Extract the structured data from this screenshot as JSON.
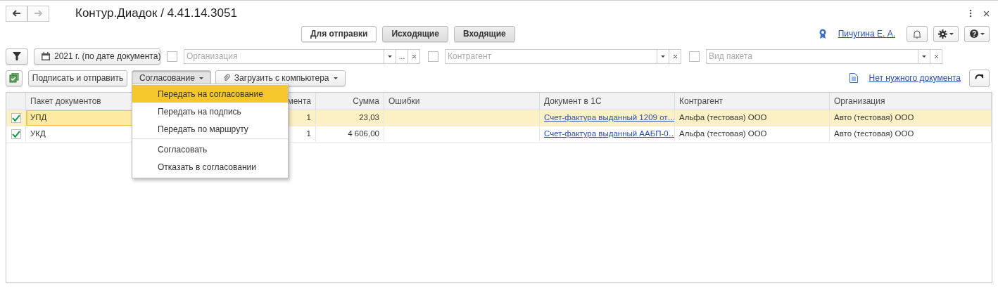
{
  "window": {
    "title": "Контур.Диадок / 4.41.14.3051"
  },
  "nav": {
    "back": {
      "disabled": false
    },
    "forward": {
      "disabled": true
    }
  },
  "mode_buttons": [
    {
      "label": "Для отправки",
      "selected": true
    },
    {
      "label": "Исходящие",
      "selected": false
    },
    {
      "label": "Входящие",
      "selected": false
    }
  ],
  "user": {
    "name": "Пичугина Е. А."
  },
  "filters": {
    "period": "2021 г. (по дате документа)",
    "fields": [
      {
        "kind": "choose",
        "placeholder": "Организация",
        "checked": false,
        "choose_button": "..."
      },
      {
        "kind": "plain",
        "placeholder": "Контрагент",
        "checked": false
      },
      {
        "kind": "plain",
        "placeholder": "Вид пакета",
        "checked": false
      }
    ]
  },
  "toolbar": {
    "sign_button": "Подписать и отправить",
    "approval_button": "Согласование",
    "upload_button": "Загрузить с компьютера",
    "missing_link": "Нет нужного документа"
  },
  "table": {
    "columns": [
      "Пакет документов",
      "мента",
      "Сумма",
      "Ошибки",
      "Документ в 1С",
      "Контрагент",
      "Организация"
    ],
    "rows": [
      {
        "checked": true,
        "selected": true,
        "package": "УПД",
        "column_3": "1",
        "sum": "23,03",
        "document": "Счет-фактура выданный 1209 от…",
        "counterparty": "Альфа (тестовая) ООО",
        "organization": "Авто (тестовая) ООО"
      },
      {
        "checked": true,
        "selected": false,
        "package": "УКД",
        "column_3": "1",
        "sum": "4 606,00",
        "document": "Счет-фактура выданный ААБП-0…",
        "counterparty": "Альфа (тестовая) ООО",
        "organization": "Авто (тестовая) ООО"
      }
    ]
  },
  "approval_menu": {
    "items": [
      {
        "label": "Передать на согласование",
        "selected": true,
        "separator_before": false
      },
      {
        "label": "Передать на подпись",
        "selected": false,
        "separator_before": false
      },
      {
        "label": "Передать по маршруту",
        "selected": false,
        "separator_before": false
      },
      {
        "label": "Согласовать",
        "selected": false,
        "separator_before": true
      },
      {
        "label": "Отказать в согласовании",
        "selected": false,
        "separator_before": false
      }
    ]
  }
}
